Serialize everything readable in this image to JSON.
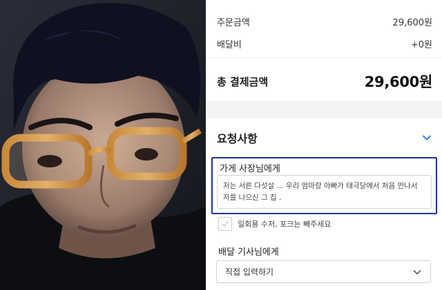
{
  "order_summary": {
    "order_amount_label": "주문금액",
    "order_amount_value": "29,600원",
    "delivery_fee_label": "배달비",
    "delivery_fee_value": "+0원",
    "total_label": "총 결제금액",
    "total_value": "29,600원"
  },
  "requests": {
    "title": "요청사항",
    "store": {
      "label": "가게 사장님에게",
      "value": "저는 서른 다섯살 ... 우리 엄마랑 아빠가 태극당에서 처음 만나서 저를 나으신 그 집 ."
    },
    "utensils_checkbox": {
      "label": "일회용 수저, 포크는 빼주세요",
      "checked": false
    },
    "rider": {
      "label": "배달 기사님에게",
      "selected": "직접 입력하기"
    }
  },
  "colors": {
    "accent_blue": "#1f2fa8",
    "chevron_blue": "#2a7de1",
    "section_gap": "#f3f4f6"
  },
  "icons": {
    "section_toggle": "chevron-down-icon",
    "select_toggle": "chevron-down-icon",
    "checkbox_mark": "check-icon"
  }
}
